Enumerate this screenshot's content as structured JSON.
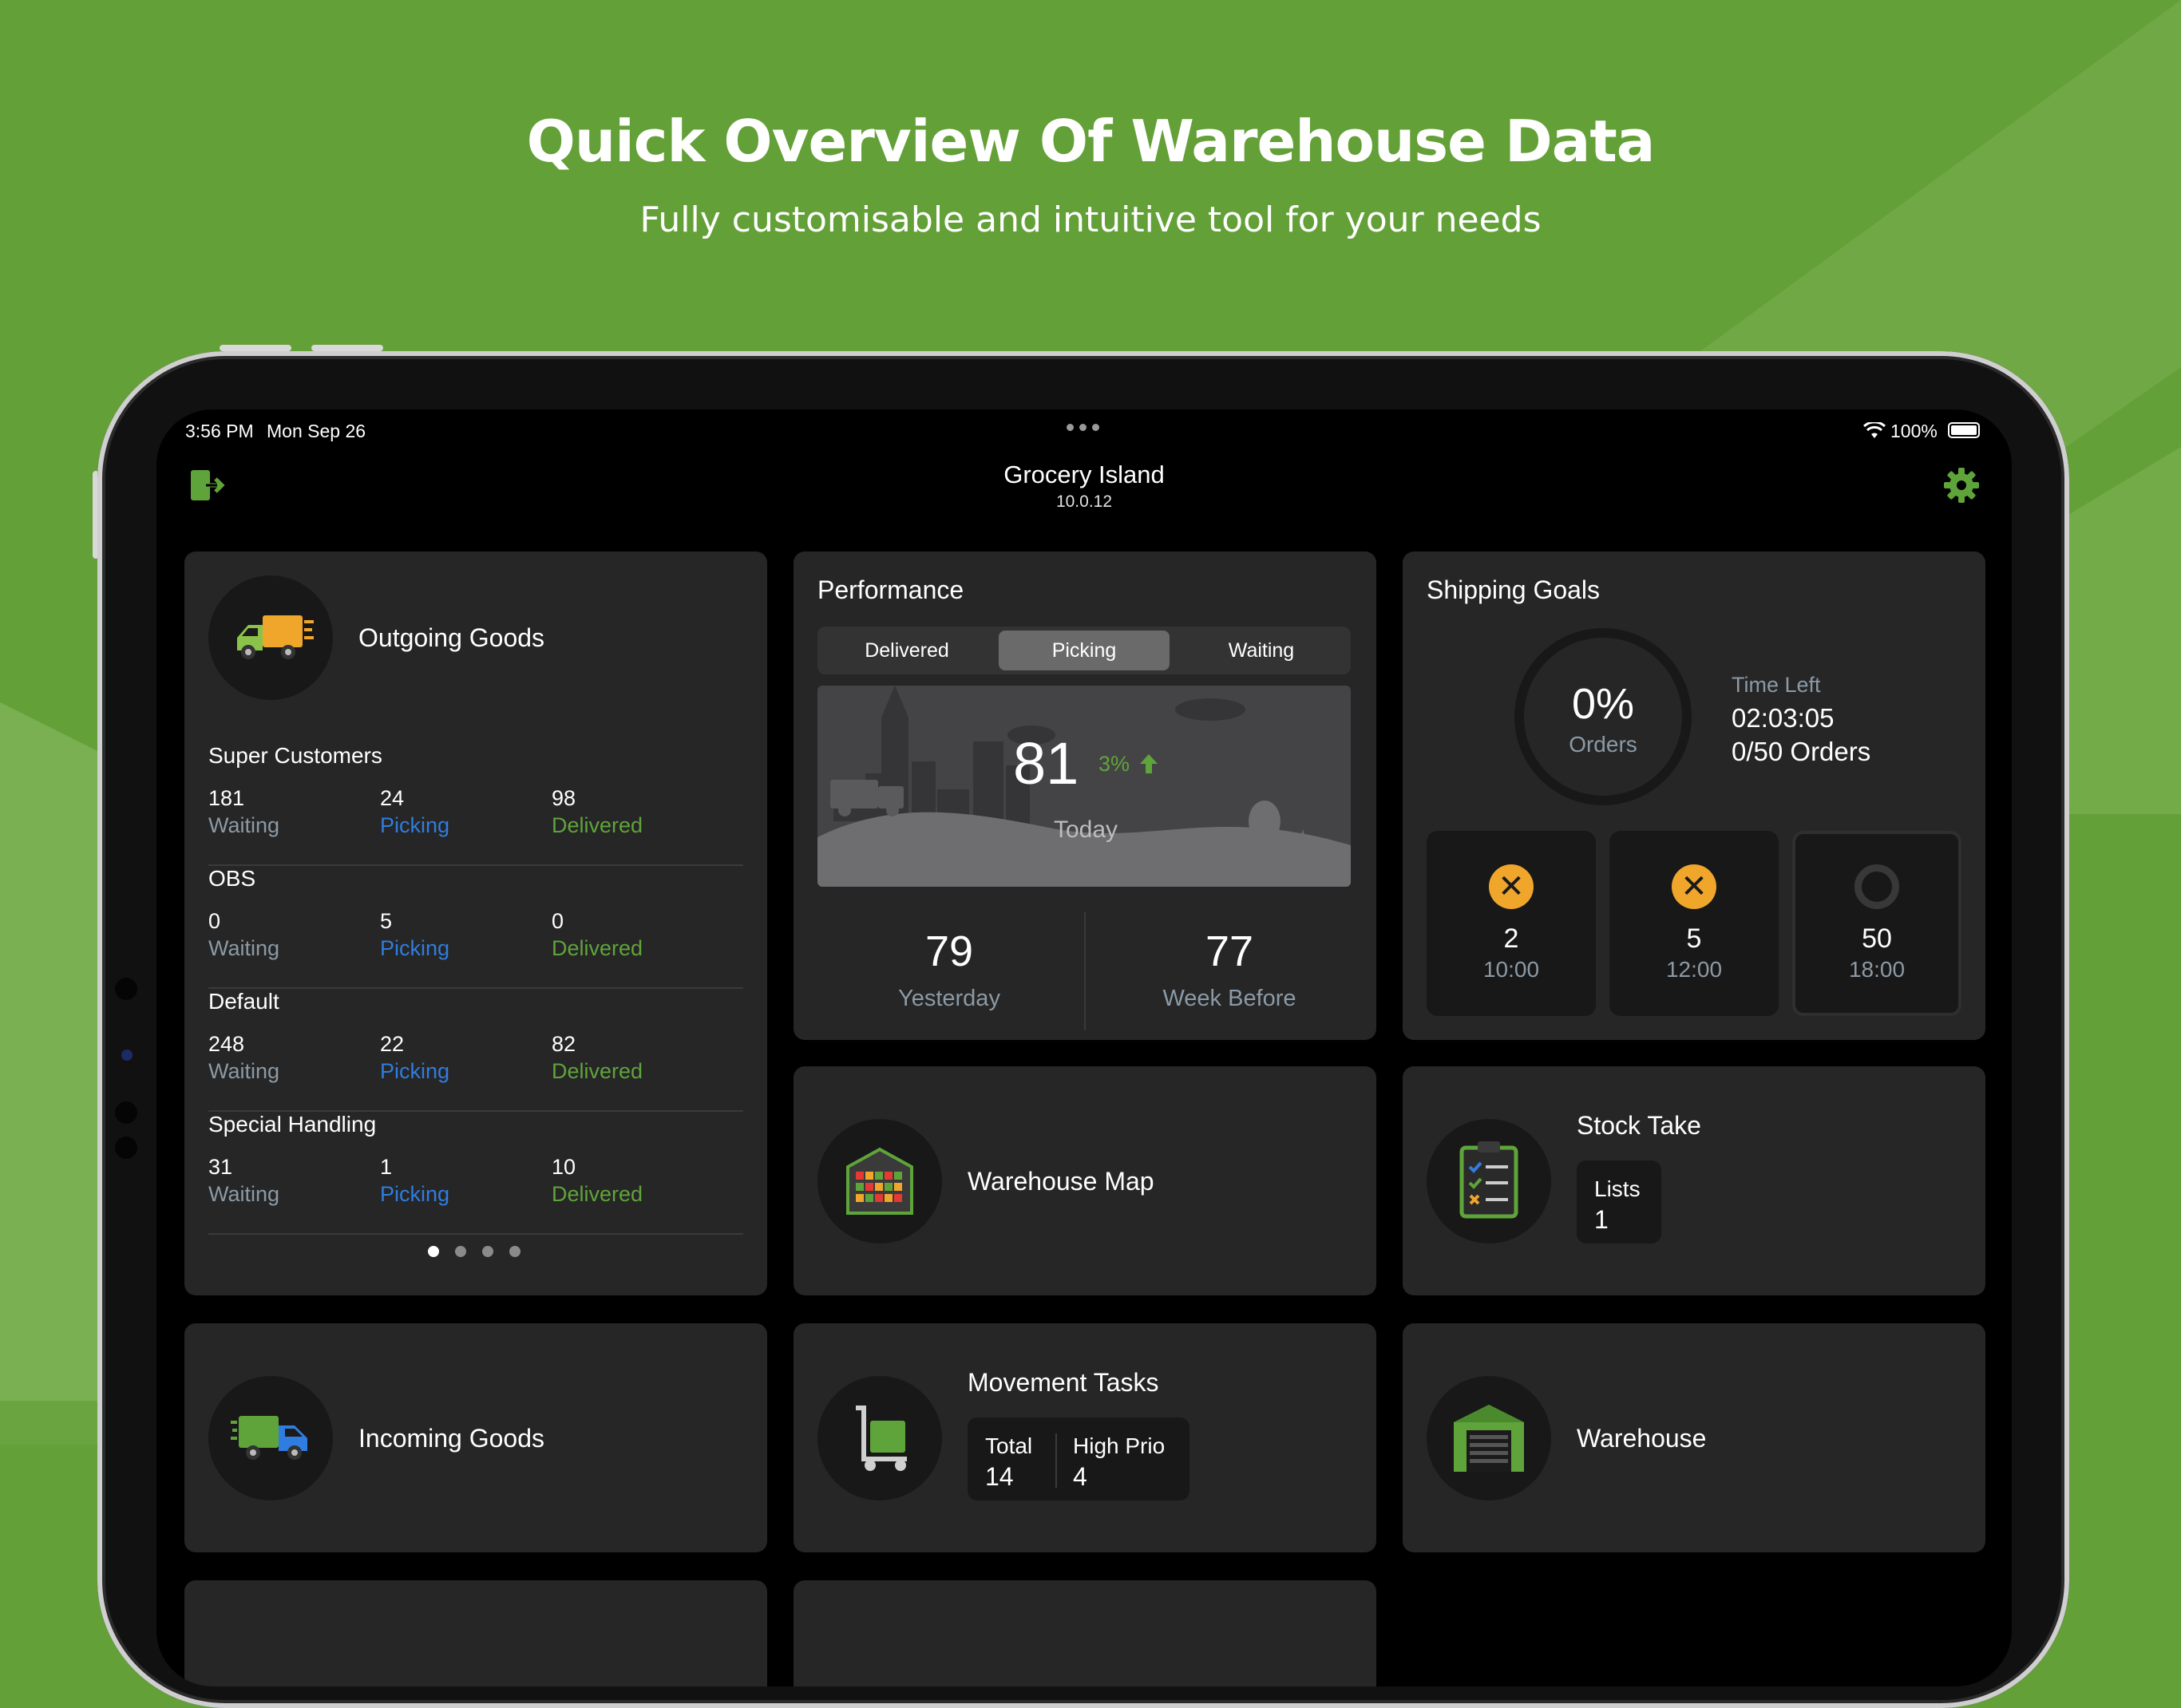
{
  "promo": {
    "headline": "Quick Overview Of Warehouse Data",
    "subline": "Fully customisable and intuitive tool for your needs"
  },
  "status_bar": {
    "time": "3:56 PM",
    "date": "Mon Sep 26",
    "battery": "100%"
  },
  "nav": {
    "title": "Grocery Island",
    "version": "10.0.12",
    "logout_icon": "logout-icon",
    "settings_icon": "gear-icon"
  },
  "outgoing": {
    "title": "Outgoing Goods",
    "groups": [
      {
        "name": "Super Customers",
        "waiting": "181",
        "picking": "24",
        "delivered": "98"
      },
      {
        "name": "OBS",
        "waiting": "0",
        "picking": "5",
        "delivered": "0"
      },
      {
        "name": "Default",
        "waiting": "248",
        "picking": "22",
        "delivered": "82"
      },
      {
        "name": "Special Handling",
        "waiting": "31",
        "picking": "1",
        "delivered": "10"
      }
    ],
    "labels": {
      "waiting": "Waiting",
      "picking": "Picking",
      "delivered": "Delivered"
    },
    "page_count": 4,
    "current_page": 1
  },
  "performance": {
    "title": "Performance",
    "tabs": [
      "Delivered",
      "Picking",
      "Waiting"
    ],
    "active_tab": "Picking",
    "today_value": "81",
    "today_change": "3%",
    "today_label": "Today",
    "yesterday_value": "79",
    "yesterday_label": "Yesterday",
    "week_before_value": "77",
    "week_before_label": "Week Before"
  },
  "shipping": {
    "title": "Shipping Goals",
    "progress": "0%",
    "progress_label": "Orders",
    "time_left_label": "Time Left",
    "time_left": "02:03:05",
    "orders": "0/50 Orders",
    "slots": [
      {
        "count": "2",
        "time": "10:00",
        "state": "missed"
      },
      {
        "count": "5",
        "time": "12:00",
        "state": "missed"
      },
      {
        "count": "50",
        "time": "18:00",
        "state": "pending"
      }
    ]
  },
  "tiles": {
    "warehouse_map": "Warehouse Map",
    "stock_take": {
      "title": "Stock Take",
      "lists_label": "Lists",
      "lists_value": "1"
    },
    "incoming": "Incoming Goods",
    "movement": {
      "title": "Movement Tasks",
      "total_label": "Total",
      "total_value": "14",
      "prio_label": "High Prio",
      "prio_value": "4"
    },
    "warehouse": "Warehouse"
  },
  "colors": {
    "background_green": "#64a038",
    "accent_green": "#5fa43a",
    "picking_blue": "#2f7de0",
    "warning_orange": "#f0a62b",
    "card": "#262626"
  }
}
